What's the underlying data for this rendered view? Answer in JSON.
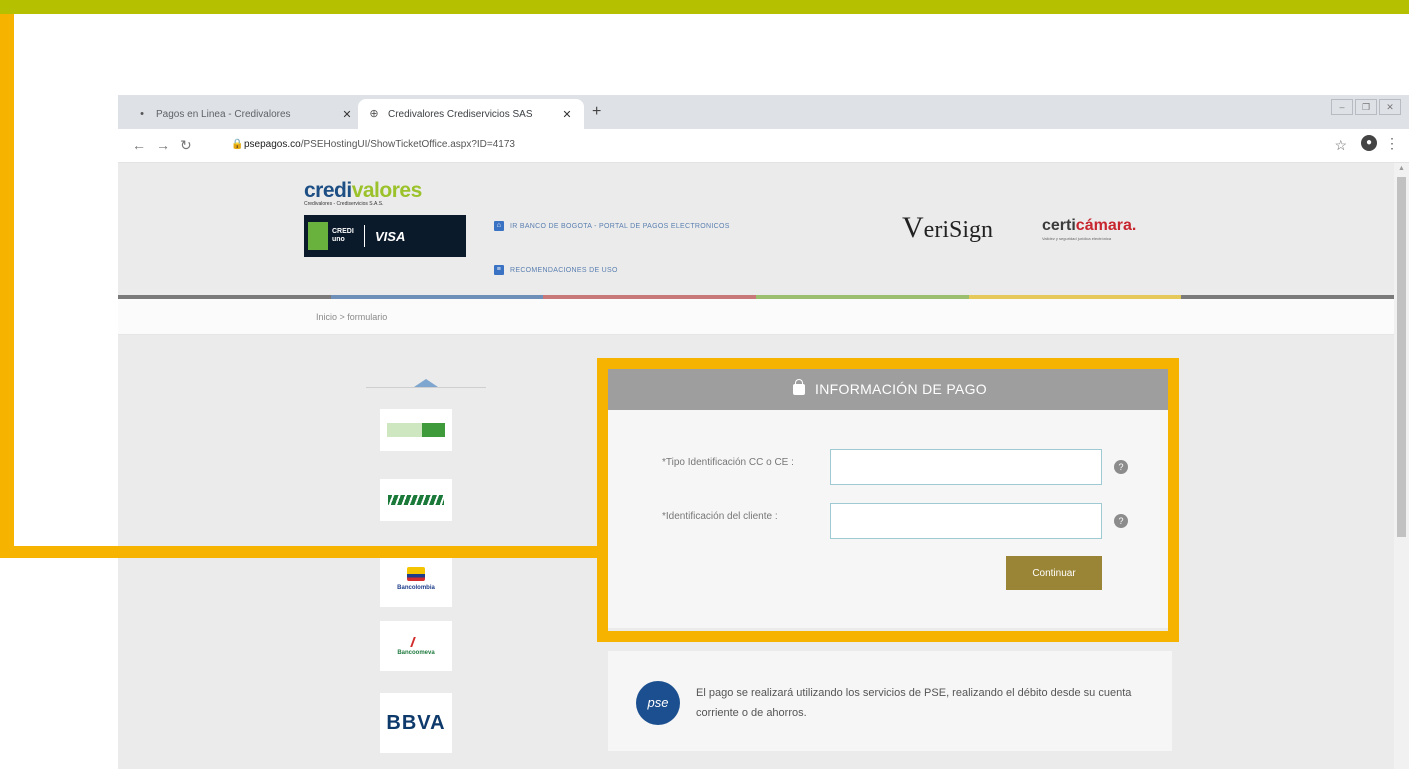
{
  "browser": {
    "tabs": [
      {
        "label": "Pagos en Linea - Credivalores",
        "active": false
      },
      {
        "label": "Credivalores Crediservicios SAS",
        "active": true
      }
    ],
    "new_tab": "+",
    "url_host": "psepagos.co",
    "url_path": "/PSEHostingUI/ShowTicketOffice.aspx?ID=4173"
  },
  "header": {
    "brand_main": "credi",
    "brand_accent": "valores",
    "brand_sub": "Credivalores - Crediservicios S.A.S.",
    "card_line": "CREDI uno",
    "card_visa": "VISA",
    "link_portal": "ir banco de bogota - portal de pagos electronicos",
    "link_recommend": "RECOMENDACIONES DE USO",
    "verisign_v": "V",
    "verisign_rest": "eriSign",
    "certicamara_a": "certi",
    "certicamara_b": "cámara.",
    "certicamara_sub": "Validez y seguridad jurídica electrónica"
  },
  "breadcrumb": "Inicio > formulario",
  "banks": [
    "Banco Caja Social",
    "Banco de Bogotá",
    "Bancolombia",
    "Bancoomeva",
    "BBVA"
  ],
  "payment": {
    "title": "INFORMACIÓN DE PAGO",
    "field1_label": "*Tipo Identificación CC o CE :",
    "field1_value": "",
    "field2_label": "*Identificación del cliente :",
    "field2_value": "",
    "help": "?",
    "continue": "Continuar"
  },
  "pse": {
    "logo": "pse",
    "text": "El pago se realizará utilizando los servicios de PSE, realizando el débito desde su cuenta corriente o de ahorros."
  },
  "colors": {
    "top_band": "#b5c000",
    "highlight": "#f6b400",
    "button": "#9a8536",
    "panel_header": "#9e9e9e"
  }
}
